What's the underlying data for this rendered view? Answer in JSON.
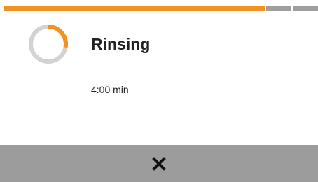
{
  "progress": {
    "value": 0.83,
    "remaining_segments": 2,
    "colors": {
      "fill": "#f29220",
      "track": "#9e9e9e"
    }
  },
  "status": {
    "title": "Rinsing",
    "time": "4:00 min",
    "ring_fraction": 0.28,
    "colors": {
      "ring_active": "#f29220",
      "ring_track": "#d3d3d3"
    }
  },
  "footer": {
    "close_icon": "close-icon",
    "background_color": "#9c9c9c"
  }
}
